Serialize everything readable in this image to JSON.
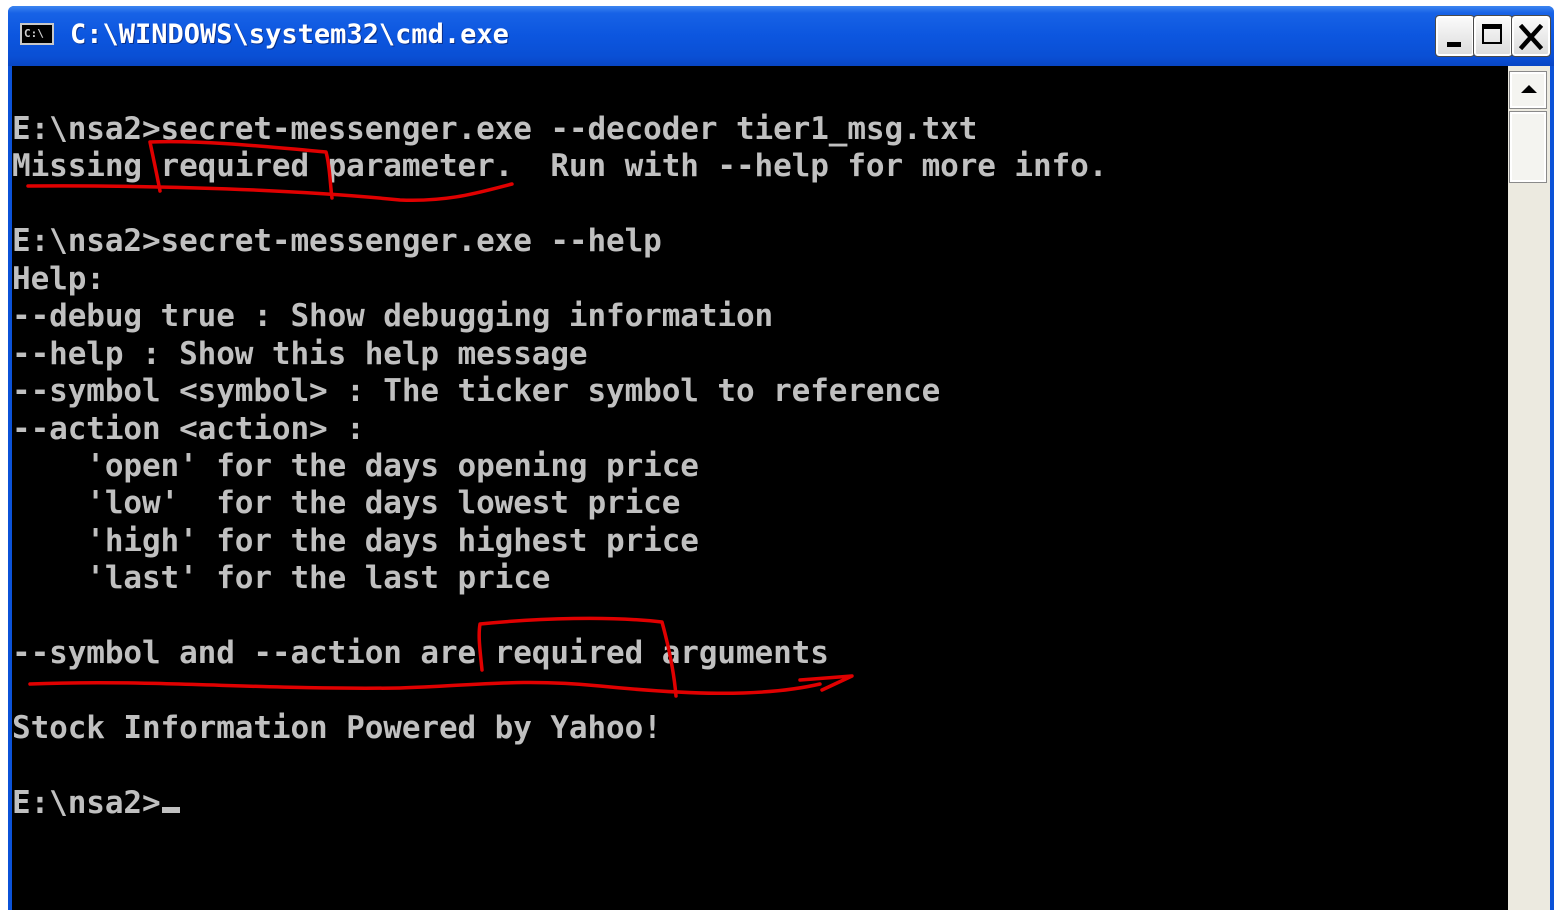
{
  "window": {
    "title": "C:\\WINDOWS\\system32\\cmd.exe",
    "icon": "cmd-icon",
    "icon_text": "C:\\",
    "buttons": {
      "minimize": "minimize-icon",
      "maximize": "maximize-icon",
      "close": "close-icon"
    }
  },
  "console": {
    "text_color": "#c0c0c0",
    "background": "#000000",
    "annotation_color": "#e00000",
    "lines": [
      "E:\\nsa2>secret-messenger.exe --decoder tier1_msg.txt",
      "Missing required parameter.  Run with --help for more info.",
      "",
      "E:\\nsa2>secret-messenger.exe --help",
      "Help:",
      "--debug true : Show debugging information",
      "--help : Show this help message",
      "--symbol <symbol> : The ticker symbol to reference",
      "--action <action> :",
      "    'open' for the days opening price",
      "    'low'  for the days lowest price",
      "    'high' for the days highest price",
      "    'last' for the last price",
      "",
      "--symbol and --action are required arguments",
      "",
      "Stock Information Powered by Yahoo!",
      "",
      "E:\\nsa2>"
    ]
  },
  "scrollbar": {
    "up_icon": "arrow-up-icon"
  }
}
